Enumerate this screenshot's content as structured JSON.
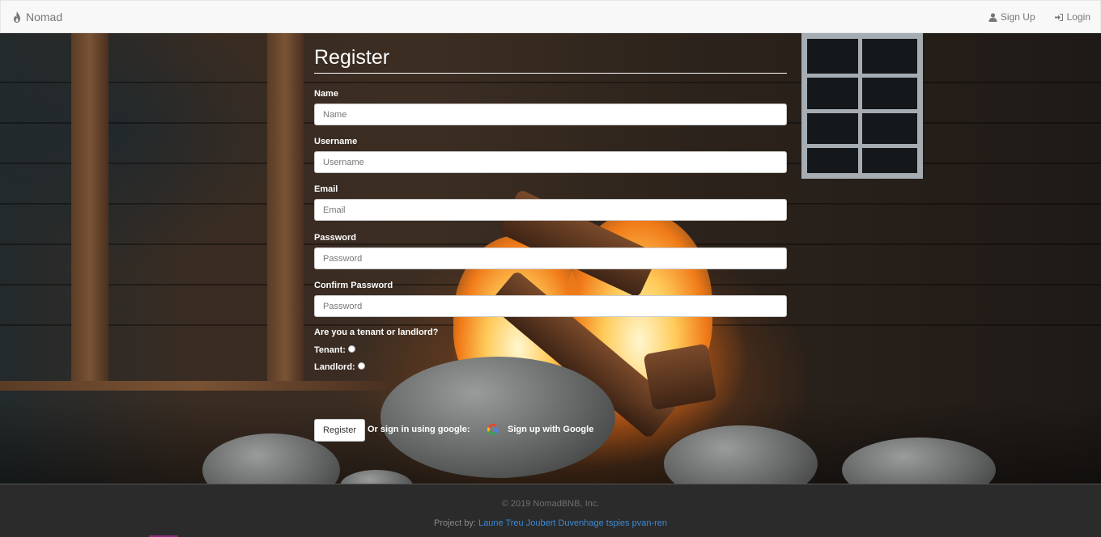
{
  "navbar": {
    "brand": "Nomad",
    "links": [
      {
        "label": "Sign Up",
        "icon": "user-icon"
      },
      {
        "label": "Login",
        "icon": "login-icon"
      }
    ]
  },
  "form": {
    "title": "Register",
    "fields": [
      {
        "label": "Name",
        "placeholder": "Name"
      },
      {
        "label": "Username",
        "placeholder": "Username"
      },
      {
        "label": "Email",
        "placeholder": "Email"
      },
      {
        "label": "Password",
        "placeholder": "Password"
      },
      {
        "label": "Confirm Password",
        "placeholder": "Password"
      }
    ],
    "role_question": "Are you a tenant or landlord?",
    "role_options": [
      "Tenant:",
      "Landlord:"
    ],
    "submit_label": "Register",
    "alt_text": "Or sign in using google:",
    "google_label": "Sign up with Google"
  },
  "footer": {
    "copyright": "© 2019 NomadBNB, Inc.",
    "project_prefix": "Project by:",
    "authors": "Laune Treu Joubert Duvenhage tspies pvan-ren"
  },
  "colors": {
    "navbar_bg": "#f8f8f8",
    "footer_bg": "#2b2b2b",
    "link_blue": "#3b8ad6"
  }
}
